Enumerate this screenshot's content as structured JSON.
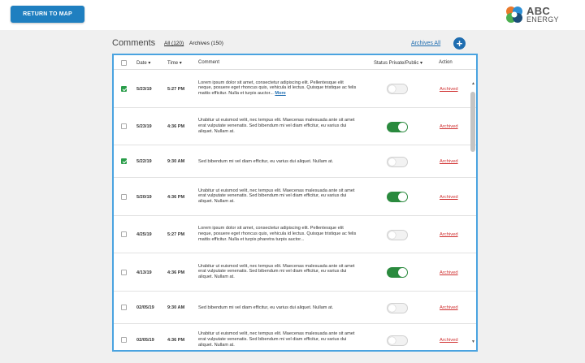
{
  "header": {
    "return_label": "RETURN TO MAP",
    "logo_abc": "ABC",
    "logo_energy": "ENERGY"
  },
  "comments": {
    "title": "Comments",
    "tab_all": "All (120)",
    "tab_archives": "Archives (150)",
    "archives_all": "Archives All",
    "add_symbol": "+"
  },
  "table": {
    "columns": {
      "date": "Date ▾",
      "time": "Time ▾",
      "comment": "Comment",
      "status": "Status Private/Public ▾",
      "action": "Action"
    },
    "rows": [
      {
        "checked": true,
        "date": "5/23/19",
        "time": "5:27 PM",
        "comment": "Lorem ipsum dolor sit amet, consectetur adipiscing elit. Pellentesque elit neque, posuere eget rhoncus quis, vehicula id lectus. Quisque tristique ac felis mattis efficitur. Nulla et turpis auctor...",
        "more": "More",
        "public": false,
        "action": "Archived"
      },
      {
        "checked": false,
        "date": "5/23/19",
        "time": "4:36 PM",
        "comment": "Urabitur ut euismod velit, nec tempus elit. Maecenas malesuada ante sit amet erat vulputate venenatis. Sed bibendum mi vel diam efficitur, eu varius dui aliquet. Nullam at.",
        "more": "",
        "public": true,
        "action": "Archived"
      },
      {
        "checked": true,
        "date": "5/22/19",
        "time": "9:30 AM",
        "comment": "Sed bibendum mi vel diam efficitur, eu varius dui aliquet. Nullam at.",
        "more": "",
        "public": false,
        "action": "Archived"
      },
      {
        "checked": false,
        "date": "5/20/19",
        "time": "4:36 PM",
        "comment": "Urabitur ut euismod velit, nec tempus elit. Maecenas malesuada ante sit amet erat vulputate venenatis. Sed bibendum mi vel diam efficitur, eu varius dui aliquet. Nullam at.",
        "more": "",
        "public": true,
        "action": "Archived"
      },
      {
        "checked": false,
        "date": "4/25/19",
        "time": "5:27 PM",
        "comment": "Lorem ipsum dolor sit amet, consectetur adipiscing elit. Pellentesque elit neque, posuere eget rhoncus quis, vehicula id lectus. Quisque tristique ac felis mattis efficitur. Nulla et turpis pharetra turpis auctor...",
        "more": "",
        "public": false,
        "action": "Archived"
      },
      {
        "checked": false,
        "date": "4/13/19",
        "time": "4:36 PM",
        "comment": "Urabitur ut euismod velit, nec tempus elit. Maecenas malesuada ante sit amet erat vulputate venenatis. Sed bibendum mi vel diam efficitur, eu varius dui aliquet. Nullam at.",
        "more": "",
        "public": true,
        "action": "Archived"
      },
      {
        "checked": false,
        "date": "02/05/19",
        "time": "9:30 AM",
        "comment": "Sed bibendum mi vel diam efficitur, eu varius dui aliquet. Nullam at.",
        "more": "",
        "public": false,
        "action": "Archived"
      },
      {
        "checked": false,
        "date": "02/05/19",
        "time": "4:36 PM",
        "comment": "Urabitur ut euismod velit, nec tempus elit. Maecenas malesuada ante sit amet erat vulputate venenatis. Sed bibendum mi vel diam efficitur, eu varius dui aliquet. Nullam at.",
        "more": "",
        "public": false,
        "action": "Archived"
      }
    ]
  },
  "icons": {
    "scroll_up": "▲",
    "scroll_down": "▼"
  },
  "colors": {
    "accent": "#1f7fc0",
    "toggle_on": "#2a8a3e",
    "archived": "#d03030"
  }
}
